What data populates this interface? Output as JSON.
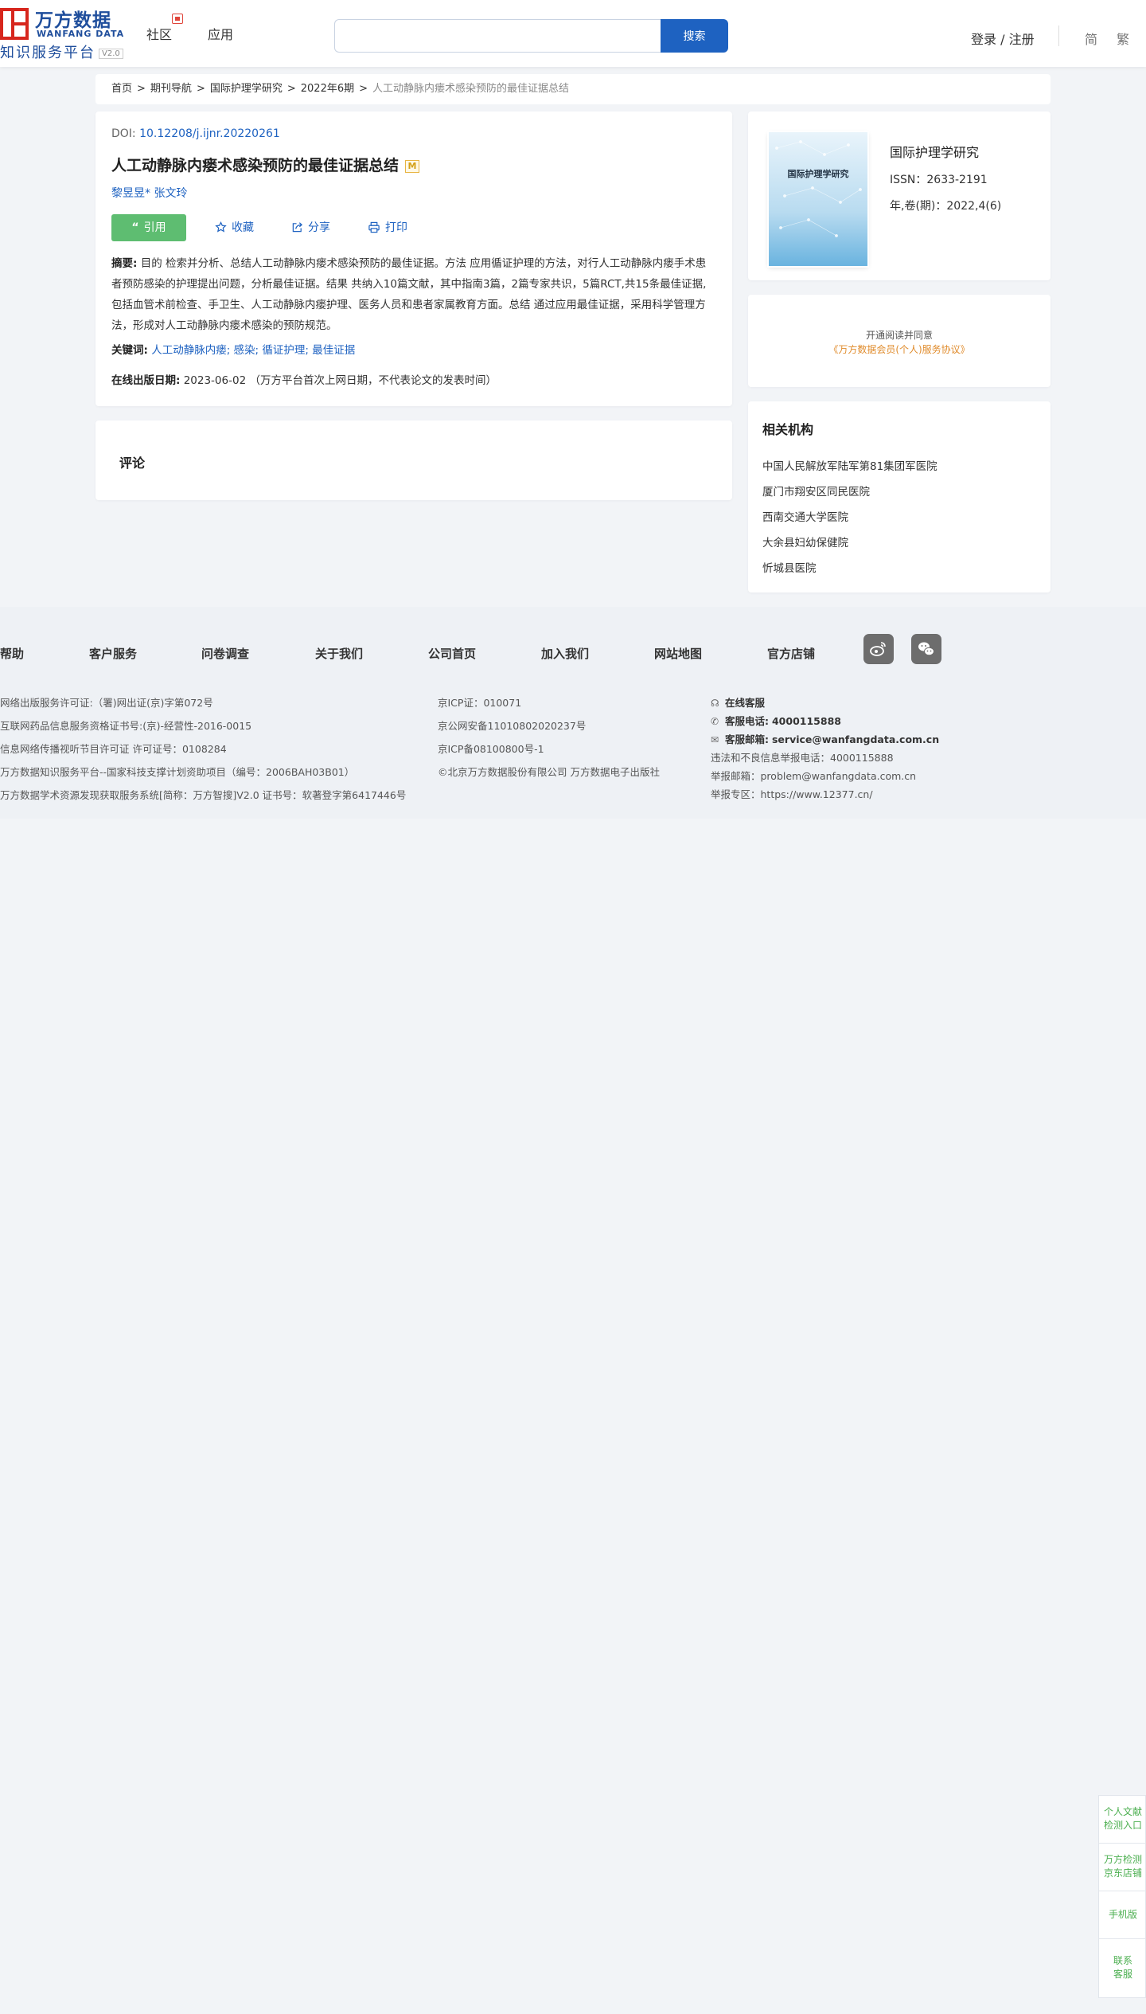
{
  "header": {
    "logo_cn": "万方数据",
    "logo_en": "WANFANG DATA",
    "logo_sub": "知识服务平台",
    "logo_version": "V2.0",
    "nav": [
      "社区",
      "应用"
    ],
    "search_placeholder": "",
    "search_button": "搜索",
    "login": "登录 / 注册",
    "lang_simplified": "简",
    "lang_traditional": "繁"
  },
  "breadcrumb": {
    "items": [
      "首页",
      "期刊导航",
      "国际护理学研究",
      "2022年6期"
    ],
    "separator": ">",
    "current": "人工动静脉内瘘术感染预防的最佳证据总结"
  },
  "article": {
    "doi_label": "DOI:",
    "doi_value": "10.12208/j.ijnr.20220261",
    "title": "人工动静脉内瘘术感染预防的最佳证据总结",
    "title_badge": "M",
    "authors": [
      "黎昱昱*",
      "张文玲"
    ],
    "actions": {
      "cite": "引用",
      "favorite": "收藏",
      "share": "分享",
      "print": "打印"
    },
    "abstract_label": "摘要:",
    "abstract_text": "目的 检索并分析、总结人工动静脉内瘘术感染预防的最佳证据。方法 应用循证护理的方法，对行人工动静脉内瘘手术患者预防感染的护理提出问题，分析最佳证据。结果 共纳入10篇文献，其中指南3篇，2篇专家共识，5篇RCT,共15条最佳证据,包括血管术前检查、手卫生、人工动静脉内瘘护理、医务人员和患者家属教育方面。总结 通过应用最佳证据，采用科学管理方法，形成对人工动静脉内瘘术感染的预防规范。",
    "keywords_label": "关键词:",
    "keywords": "人工动静脉内瘘; 感染; 循证护理; 最佳证据",
    "pubdate_label": "在线出版日期:",
    "pubdate_value": "2023-06-02  （万方平台首次上网日期，不代表论文的发表时间）"
  },
  "comment": {
    "title": "评论"
  },
  "journal": {
    "cover_title": "国际护理学研究",
    "name": "国际护理学研究",
    "issn": "ISSN：2633-2191",
    "issue": "年,卷(期)：2022,4(6)"
  },
  "access": {
    "line1": "开通阅读并同意",
    "line2": "《万方数据会员(个人)服务协议》"
  },
  "institutions": {
    "title": "相关机构",
    "items": [
      "中国人民解放军陆军第81集团军医院",
      "厦门市翔安区同民医院",
      "西南交通大学医院",
      "大余县妇幼保健院",
      "忻城县医院"
    ]
  },
  "footer": {
    "nav": [
      "帮助",
      "客户服务",
      "问卷调查",
      "关于我们",
      "公司首页",
      "加入我们",
      "网站地图",
      "官方店铺"
    ],
    "social": [
      "weibo-icon",
      "wechat-icon"
    ],
    "col1": [
      "网络出版服务许可证:（署)网出证(京)字第072号",
      "互联网药品信息服务资格证书号:(京)-经营性-2016-0015",
      "信息网络传播视听节目许可证 许可证号：0108284",
      "万方数据知识服务平台--国家科技支撑计划资助项目（编号：2006BAH03B01）",
      "万方数据学术资源发现获取服务系统[简称：万方智搜]V2.0 证书号：软著登字第6417446号"
    ],
    "col2": [
      "京ICP证：010071",
      "京公网安备11010802020237号",
      "京ICP备08100800号-1",
      "©北京万方数据股份有限公司 万方数据电子出版社"
    ],
    "col3": {
      "online_service": "在线客服",
      "phone_label": "客服电话:",
      "phone_value": "4000115888",
      "email_label": "客服邮箱:",
      "email_value": "service@wanfangdata.com.cn",
      "report_phone": "违法和不良信息举报电话：4000115888",
      "report_email": "举报邮箱：problem@wanfangdata.com.cn",
      "report_zone": "举报专区：https://www.12377.cn/"
    }
  },
  "float_panel": {
    "items": [
      [
        "个人文献",
        "检测入口"
      ],
      [
        "万方检测",
        "京东店铺"
      ],
      [
        "手机版"
      ],
      [
        "联系",
        "客服"
      ]
    ]
  },
  "colors": {
    "brand_blue": "#1e62c1",
    "logo_red": "#d7261d",
    "cite_green": "#5ebd71",
    "agreement_orange": "#e08b2b",
    "float_green": "#4caf50"
  }
}
